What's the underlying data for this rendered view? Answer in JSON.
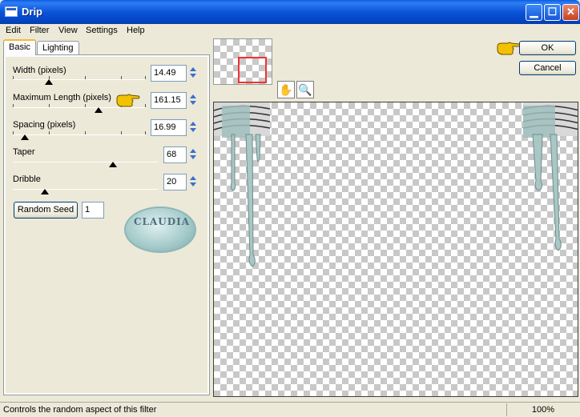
{
  "window": {
    "title": "Drip"
  },
  "menu": [
    "Edit",
    "Filter",
    "View",
    "Settings",
    "Help"
  ],
  "tabs": {
    "basic": "Basic",
    "lighting": "Lighting"
  },
  "controls": [
    {
      "label": "Width (pixels)",
      "value": "14.49"
    },
    {
      "label": "Maximum Length (pixels)",
      "value": "161.15"
    },
    {
      "label": "Spacing (pixels)",
      "value": "16.99"
    },
    {
      "label": "Taper",
      "value": "68"
    },
    {
      "label": "Dribble",
      "value": "20"
    }
  ],
  "random_seed": {
    "label": "Random Seed",
    "value": "1"
  },
  "watermark": {
    "text": "CLAUDIA"
  },
  "buttons": {
    "ok": "OK",
    "cancel": "Cancel"
  },
  "status": {
    "text": "Controls the random aspect of this filter",
    "zoom": "100%"
  },
  "colors": {
    "titlebar": "#0a54d8",
    "face": "#ece9d8",
    "pointer_hand": "#f2c200",
    "drip": "#a9c7c5"
  },
  "icons": {
    "pan": "hand-icon",
    "zoom": "magnifier-icon"
  }
}
